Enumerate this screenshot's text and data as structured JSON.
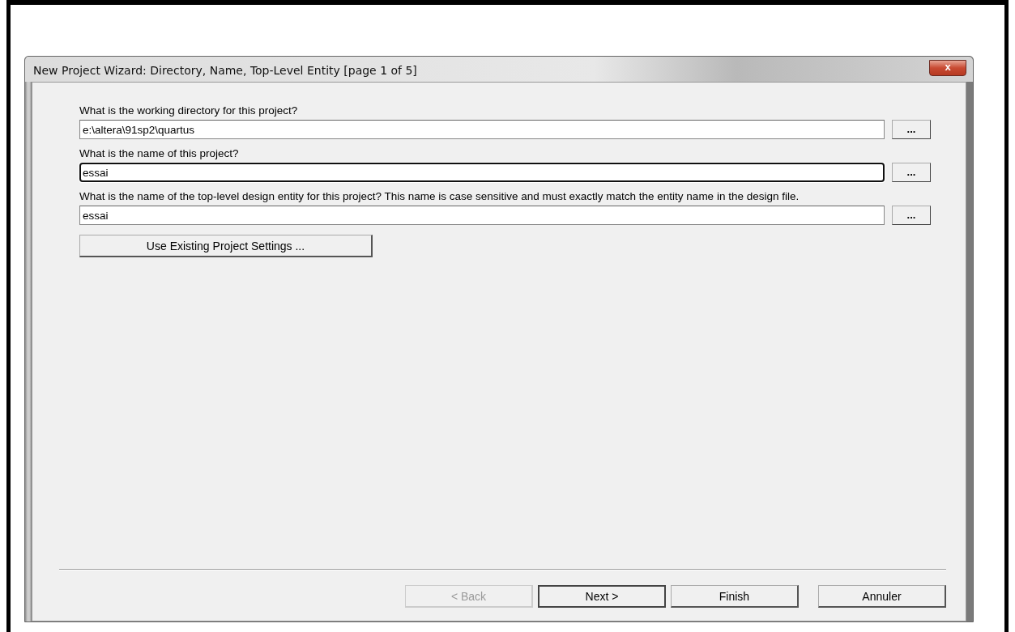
{
  "window": {
    "title": "New Project Wizard: Directory, Name, Top-Level Entity [page 1 of 5]",
    "close": "x"
  },
  "fields": [
    {
      "label": "What is the working directory for this project?",
      "value": "e:\\altera\\91sp2\\quartus",
      "browse": "...",
      "focused": false
    },
    {
      "label": "What is the name of this project?",
      "value": "essai",
      "browse": "...",
      "focused": true
    },
    {
      "label": "What is the name of the top-level design entity for this project? This name is case sensitive and must exactly match the entity name in the design file.",
      "value": "essai",
      "browse": "...",
      "focused": false
    }
  ],
  "settings_button": "Use Existing Project Settings ...",
  "buttons": [
    {
      "label": "< Back",
      "disabled": true,
      "default": false
    },
    {
      "label": "Next >",
      "disabled": false,
      "default": true
    },
    {
      "label": "Finish",
      "disabled": false,
      "default": false
    },
    {
      "label": "Annuler",
      "disabled": false,
      "default": false
    }
  ]
}
